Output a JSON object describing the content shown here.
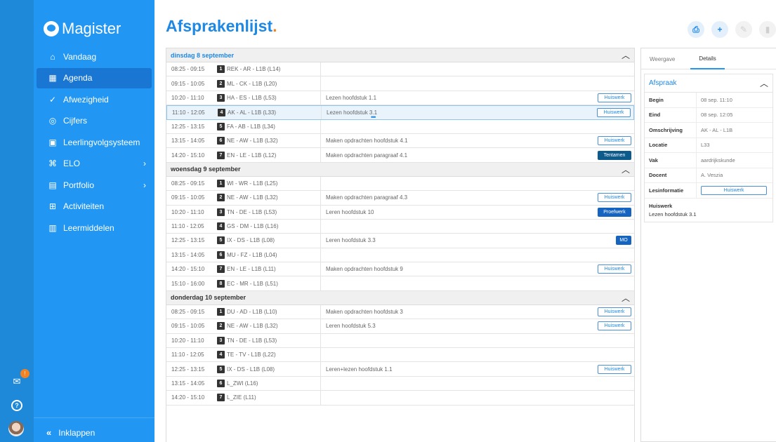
{
  "app": {
    "name": "Magister"
  },
  "sidebar": {
    "items": [
      {
        "label": "Vandaag",
        "icon": "home-icon",
        "glyph": "⌂"
      },
      {
        "label": "Agenda",
        "icon": "calendar-icon",
        "glyph": "▦"
      },
      {
        "label": "Afwezigheid",
        "icon": "check-circle-icon",
        "glyph": "✓"
      },
      {
        "label": "Cijfers",
        "icon": "grade-icon",
        "glyph": "◎"
      },
      {
        "label": "Leerlingvolgsysteem",
        "icon": "monitor-icon",
        "glyph": "▣"
      },
      {
        "label": "ELO",
        "icon": "elo-icon",
        "glyph": "⌘"
      },
      {
        "label": "Portfolio",
        "icon": "portfolio-icon",
        "glyph": "▤"
      },
      {
        "label": "Activiteiten",
        "icon": "activity-icon",
        "glyph": "⊞"
      },
      {
        "label": "Leermiddelen",
        "icon": "books-icon",
        "glyph": "▥"
      }
    ],
    "collapse_label": "Inklappen"
  },
  "rail": {
    "mail_badge": "!"
  },
  "header": {
    "title": "Afsprakenlijst",
    "title_dot": "."
  },
  "days": [
    {
      "label": "dinsdag 8 september",
      "rows": [
        {
          "time": "08:25 - 09:15",
          "num": "1",
          "les": "REK - AR - L1B (L14)",
          "note": "",
          "tag": "",
          "tag_type": ""
        },
        {
          "time": "09:15 - 10:05",
          "num": "2",
          "les": "ML - CK - L1B (L20)",
          "note": "",
          "tag": "",
          "tag_type": ""
        },
        {
          "time": "10:20 - 11:10",
          "num": "3",
          "les": "HA - ES - L1B (L53)",
          "note": "Lezen hoofdstuk 1.1",
          "tag": "Huiswerk",
          "tag_type": "hw"
        },
        {
          "time": "11:10 - 12:05",
          "num": "4",
          "les": "AK - AL - L1B (L33)",
          "note": "Lezen hoofdstuk 3.1",
          "tag": "Huiswerk",
          "tag_type": "hw"
        },
        {
          "time": "12:25 - 13:15",
          "num": "5",
          "les": "FA - AB - L1B (L34)",
          "note": "",
          "tag": "",
          "tag_type": ""
        },
        {
          "time": "13:15 - 14:05",
          "num": "6",
          "les": "NE - AW - L1B (L32)",
          "note": "Maken opdrachten hoofdstuk 4.1",
          "tag": "Huiswerk",
          "tag_type": "hw"
        },
        {
          "time": "14:20 - 15:10",
          "num": "7",
          "les": "EN - LE - L1B (L12)",
          "note": "Maken opdrachten paragraaf 4.1",
          "tag": "Tentamen",
          "tag_type": "tt"
        }
      ]
    },
    {
      "label": "woensdag 9 september",
      "rows": [
        {
          "time": "08:25 - 09:15",
          "num": "1",
          "les": "WI - WR - L1B (L25)",
          "note": "",
          "tag": "",
          "tag_type": ""
        },
        {
          "time": "09:15 - 10:05",
          "num": "2",
          "les": "NE - AW - L1B (L32)",
          "note": "Maken opdrachten paragraaf 4.3",
          "tag": "Huiswerk",
          "tag_type": "hw"
        },
        {
          "time": "10:20 - 11:10",
          "num": "3",
          "les": "TN - DE - L1B (L53)",
          "note": "Leren hoofdstuk 10",
          "tag": "Proefwerk",
          "tag_type": "pw"
        },
        {
          "time": "11:10 - 12:05",
          "num": "4",
          "les": "GS - DM - L1B (L16)",
          "note": "",
          "tag": "",
          "tag_type": ""
        },
        {
          "time": "12:25 - 13:15",
          "num": "5",
          "les": "IX - DS - L1B (L08)",
          "note": "Leren hoofdstuk 3.3",
          "tag": "MO",
          "tag_type": "mo"
        },
        {
          "time": "13:15 - 14:05",
          "num": "6",
          "les": "MU - FZ - L1B (L04)",
          "note": "",
          "tag": "",
          "tag_type": ""
        },
        {
          "time": "14:20 - 15:10",
          "num": "7",
          "les": "EN - LE - L1B (L11)",
          "note": "Maken opdrachten hoofdstuk 9",
          "tag": "Huiswerk",
          "tag_type": "hw"
        },
        {
          "time": "15:10 - 16:00",
          "num": "8",
          "les": "EC - MR - L1B (L51)",
          "note": "",
          "tag": "",
          "tag_type": ""
        }
      ]
    },
    {
      "label": "donderdag 10 september",
      "rows": [
        {
          "time": "08:25 - 09:15",
          "num": "1",
          "les": "DU - AD - L1B (L10)",
          "note": "Maken opdrachten hoofdstuk 3",
          "tag": "Huiswerk",
          "tag_type": "hw"
        },
        {
          "time": "09:15 - 10:05",
          "num": "2",
          "les": "NE - AW - L1B (L32)",
          "note": "Leren hoofdstuk 5.3",
          "tag": "Huiswerk",
          "tag_type": "hw"
        },
        {
          "time": "10:20 - 11:10",
          "num": "3",
          "les": "TN - DE - L1B (L53)",
          "note": "",
          "tag": "",
          "tag_type": ""
        },
        {
          "time": "11:10 - 12:05",
          "num": "4",
          "les": "TE - TV - L1B (L22)",
          "note": "",
          "tag": "",
          "tag_type": ""
        },
        {
          "time": "12:25 - 13:15",
          "num": "5",
          "les": "IX - DS - L1B (L08)",
          "note": "Leren+lezen hoofdstuk 1.1",
          "tag": "Huiswerk",
          "tag_type": "hw"
        },
        {
          "time": "13:15 - 14:05",
          "num": "6",
          "les": "L_ZWI (L16)",
          "note": "",
          "tag": "",
          "tag_type": ""
        },
        {
          "time": "14:20 - 15:10",
          "num": "7",
          "les": "L_ZIE (L11)",
          "note": "",
          "tag": "",
          "tag_type": ""
        }
      ]
    }
  ],
  "selected": {
    "day": 0,
    "row": 3
  },
  "panel": {
    "tabs": [
      "Weergave",
      "Details"
    ],
    "active_tab": 1,
    "section_title": "Afspraak",
    "details": [
      {
        "key": "Begin",
        "value": "08 sep. 11:10"
      },
      {
        "key": "Eind",
        "value": "08 sep. 12:05"
      },
      {
        "key": "Omschrijving",
        "value": "AK - AL - L1B"
      },
      {
        "key": "Locatie",
        "value": "L33"
      },
      {
        "key": "Vak",
        "value": "aardrijkskunde"
      },
      {
        "key": "Docent",
        "value": "A. Veszia"
      }
    ],
    "lesinfo_key": "Lesinformatie",
    "lesinfo_button": "Huiswerk",
    "huiswerk_key": "Huiswerk",
    "huiswerk_value": "Lezen hoofdstuk 3.1"
  },
  "colors": {
    "sidebar": "#2196f3",
    "rail": "#1e88d9",
    "accent": "#1e88e5",
    "dot": "#f58220"
  }
}
